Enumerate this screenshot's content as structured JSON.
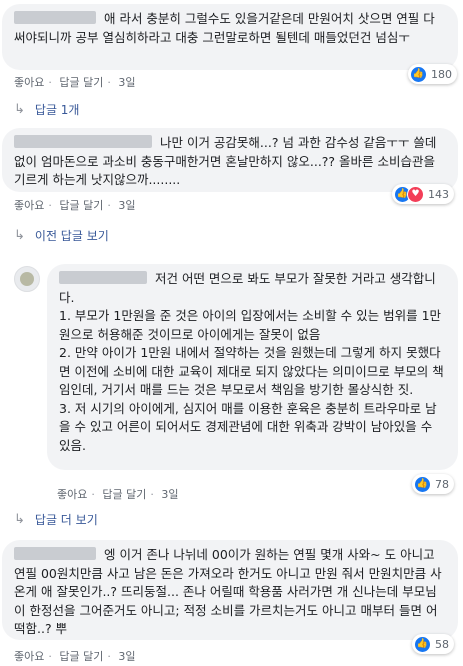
{
  "comments": [
    {
      "text": "애 라서 충분히 그럴수도 있을거같은데 만원어치 삿으면 연필 다 써야되니까 공부 열심히하라고 대충 그런말로하면 될텐데 매들었던건 넘심ㅜ",
      "like_label": "좋아요",
      "reply_label": "답글 달기",
      "time": "3일",
      "reaction_count": "180",
      "reactions": [
        "like-icon"
      ]
    },
    {
      "text": "나만 이거 공감못해...? 넘 과한 감수성 같음ㅜㅜ 쓸데없이 엄마돈으로 과소비 충동구매한거면 혼날만하지 않오...?? 올바른 소비습관을 기르게 하는게 낫지않으까........",
      "like_label": "좋아요",
      "reply_label": "답글 달기",
      "time": "3일",
      "reaction_count": "143",
      "reactions": [
        "like-icon",
        "love-icon"
      ]
    },
    {
      "text": "저건 어떤 면으로 봐도 부모가 잘못한 거라고 생각합니다.\n1. 부모가 1만원을 준 것은 아이의 입장에서는 소비할 수 있는 범위를 1만원으로 허용해준 것이므로 아이에게는 잘못이 없음\n2. 만약 아이가 1만원 내에서 절약하는 것을 원했는데 그렇게 하지 못했다면 이전에 소비에 대한 교육이 제대로 되지 않았다는 의미이므로 부모의 책임인데, 거기서 매를 드는 것은 부모로서 책임을 방기한 몰상식한 짓.\n3. 저 시기의 아이에게, 심지어 매를 이용한 훈육은 충분히 트라우마로 남을 수 있고 어른이 되어서도 경제관념에 대한 위축과 강박이 남아있을 수 있음.",
      "like_label": "좋아요",
      "reply_label": "답글 달기",
      "time": "3일",
      "reaction_count": "78",
      "reactions": [
        "like-icon"
      ]
    },
    {
      "text": "엥 이거 존나 나뉘네 00이가 원하는 연필 몇개 사와~ 도 아니고 연필 00원치만큼 사고 남은 돈은 가져오라 한거도 아니고 만원 줘서 만원치만큼 사온게 애 잘못인가..? 뜨리둥절... 존나 어릴때 학용품 사러가면 개 신나는데 부모님이 한정선을 그어준거도 아니고; 적정 소비를 가르치는거도 아니고 매부터 들면 어떡함..? 뿌",
      "like_label": "좋아요",
      "reply_label": "답글 달기",
      "time": "3일",
      "reaction_count": "58",
      "reactions": [
        "like-icon"
      ]
    }
  ],
  "links": {
    "reply_one": "답글 1개",
    "prev_replies": "이전 답글 보기",
    "more_replies": "답글 더 보기"
  }
}
